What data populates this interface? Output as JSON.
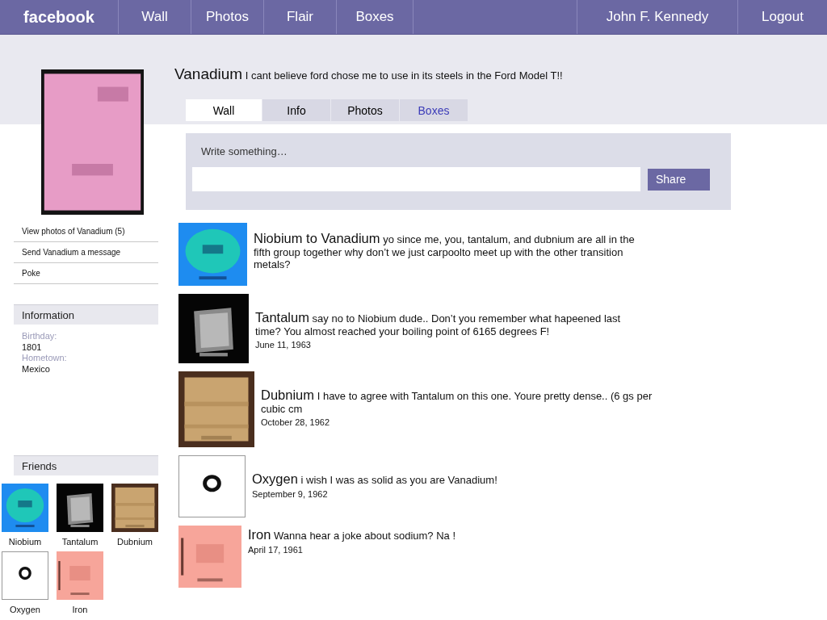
{
  "nav": {
    "brand": "facebook",
    "links": [
      "Wall",
      "Photos",
      "Flair",
      "Boxes"
    ],
    "user": "John F. Kennedy",
    "logout": "Logout"
  },
  "profile": {
    "picture": {
      "kind": "picture"
    },
    "actions": [
      "View photos of Vanadium (5)",
      "Send Vanadium a message",
      "Poke"
    ]
  },
  "information": {
    "title": "Information",
    "fields": [
      {
        "label": "Birthday:",
        "value": "1801"
      },
      {
        "label": "Hometown:",
        "value": "Mexico"
      }
    ]
  },
  "friends": {
    "title": "Friends",
    "items": [
      {
        "name": "Niobium",
        "picture": {
          "kind": "picture"
        }
      },
      {
        "name": "Tantalum",
        "picture": {
          "kind": "picture"
        }
      },
      {
        "name": "Dubnium",
        "picture": {
          "kind": "picture"
        }
      },
      {
        "name": "Oxygen",
        "picture": {
          "kind": "picture"
        }
      },
      {
        "name": "Iron",
        "picture": {
          "kind": "picture"
        }
      }
    ]
  },
  "status": {
    "name": "Vanadium",
    "text": "I cant believe ford chose me to use in its steels in the Ford Model T!!"
  },
  "tabs": [
    {
      "label": "Wall",
      "selected": true,
      "color": "#000000"
    },
    {
      "label": "Info",
      "selected": false,
      "color": "#000000"
    },
    {
      "label": "Photos",
      "selected": false,
      "color": "#000000"
    },
    {
      "label": "Boxes",
      "selected": false,
      "color": "#3b3bb8"
    }
  ],
  "composer": {
    "label": "Write something…",
    "button": "Share"
  },
  "posts": [
    {
      "author": "Niobium to Vanadium",
      "message": "yo since me, you, tantalum, and dubnium are all in the fifth group together why don’t we just carpoolto meet up with the other transition metals?",
      "picture": {
        "kind": "picture"
      }
    },
    {
      "author": "Tantalum",
      "message": "say no to Niobium dude.. Don’t you remember what hapeened last time? You almost reached your boiling point of 6165 degrees F!",
      "date": "June 11, 1963",
      "picture": {
        "kind": "picture"
      }
    },
    {
      "author": "Dubnium",
      "message": "I have to agree with Tantalum on this one. Youre pretty dense.. (6 gs per cubic cm",
      "date": "October 28, 1962",
      "picture": {
        "kind": "picture"
      }
    },
    {
      "author": "Oxygen",
      "message": "i wish I was as solid as you are Vanadium!",
      "date": "September 9, 1962",
      "picture": {
        "kind": "picture"
      }
    },
    {
      "author": "Iron",
      "message": "Wanna hear a joke about sodium? Na !",
      "date": "April 17, 1961",
      "picture": {
        "kind": "picture"
      }
    }
  ]
}
